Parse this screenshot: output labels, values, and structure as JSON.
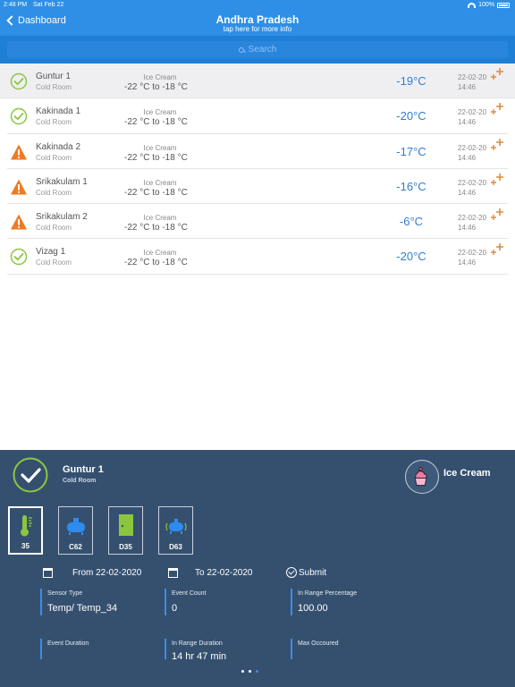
{
  "status_bar": {
    "time": "2:48 PM",
    "date": "Sat Feb 22",
    "battery": "100%"
  },
  "nav": {
    "back_label": "Dashboard",
    "title": "Andhra Pradesh",
    "subtitle": "tap here for more info"
  },
  "search": {
    "placeholder": "Search"
  },
  "rows": [
    {
      "status": "ok",
      "name": "Guntur 1",
      "sub": "Cold Room",
      "product": "Ice Cream",
      "range": "-22 °C to -18 °C",
      "temp": "-19°C",
      "date": "22-02-20",
      "time": "14:46"
    },
    {
      "status": "ok",
      "name": "Kakinada 1",
      "sub": "Cold Room",
      "product": "Ice Cream",
      "range": "-22 °C to -18 °C",
      "temp": "-20°C",
      "date": "22-02-20",
      "time": "14:46"
    },
    {
      "status": "warn",
      "name": "Kakinada 2",
      "sub": "Cold Room",
      "product": "Ice Cream",
      "range": "-22 °C to -18 °C",
      "temp": "-17°C",
      "date": "22-02-20",
      "time": "14:46"
    },
    {
      "status": "warn",
      "name": "Srikakulam 1",
      "sub": "Cold Room",
      "product": "Ice Cream",
      "range": "-22 °C to -18 °C",
      "temp": "-16°C",
      "date": "22-02-20",
      "time": "14:46"
    },
    {
      "status": "warn",
      "name": "Srikakulam 2",
      "sub": "Cold Room",
      "product": "Ice Cream",
      "range": "-22 °C to -18 °C",
      "temp": "-6°C",
      "date": "22-02-20",
      "time": "14:46"
    },
    {
      "status": "ok",
      "name": "Vizag 1",
      "sub": "Cold Room",
      "product": "Ice Cream",
      "range": "-22 °C to -18 °C",
      "temp": "-20°C",
      "date": "22-02-20",
      "time": "14:46"
    }
  ],
  "panel": {
    "name": "Guntur 1",
    "sub": "Cold Room",
    "product": "Ice Cream",
    "sensors": [
      {
        "label": "35",
        "icon": "thermometer-icon"
      },
      {
        "label": "C62",
        "icon": "compressor-icon"
      },
      {
        "label": "D35",
        "icon": "door-icon"
      },
      {
        "label": "D63",
        "icon": "compressor-vibration-icon"
      }
    ],
    "from_label": "From 22-02-2020",
    "to_label": "To 22-02-2020",
    "submit_label": "Submit",
    "fields": {
      "sensor_type_label": "Sensor Type",
      "sensor_type_value": "Temp/ Temp_34",
      "event_count_label": "Event Count",
      "event_count_value": "0",
      "in_range_pct_label": "In Range Percentage",
      "in_range_pct_value": "100.00",
      "event_duration_label": "Event Duration",
      "in_range_duration_label": "In Range Duration",
      "in_range_duration_value": "14 hr 47 min",
      "max_occured_label": "Max Occoured"
    }
  },
  "colors": {
    "ok": "#8cc63f",
    "warn": "#f07a22",
    "temp": "#2f7fd0",
    "plus": "#e08a3c",
    "panel": "#35506f",
    "accent": "#3a8ee8"
  }
}
